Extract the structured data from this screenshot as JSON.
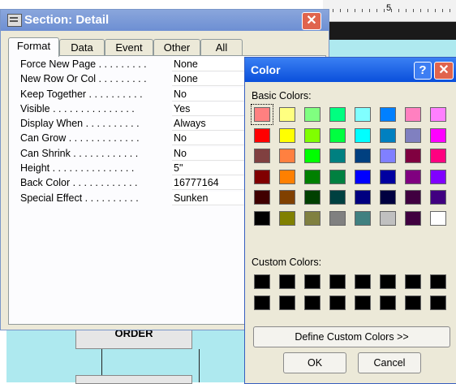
{
  "properties_window": {
    "title": "Section: Detail",
    "close_glyph": "✕",
    "tabs": [
      {
        "label": "Format",
        "active": true
      },
      {
        "label": "Data",
        "active": false
      },
      {
        "label": "Event",
        "active": false
      },
      {
        "label": "Other",
        "active": false
      },
      {
        "label": "All",
        "active": false
      }
    ],
    "properties": [
      {
        "name": "Force New Page . . . . . . . . .",
        "value": "None"
      },
      {
        "name": "New Row Or Col . . . . . . . . .",
        "value": "None"
      },
      {
        "name": "Keep Together . . . . . . . . . .",
        "value": "No"
      },
      {
        "name": "Visible . . . . . . . . . . . . . . .",
        "value": "Yes"
      },
      {
        "name": "Display When . . . . . . . . . .",
        "value": "Always"
      },
      {
        "name": "Can Grow . . . . . . . . . . . . .",
        "value": "No"
      },
      {
        "name": "Can Shrink . . . . . . . . . . . .",
        "value": "No"
      },
      {
        "name": "Height . . . . . . . . . . . . . . .",
        "value": "5\""
      },
      {
        "name": "Back Color . . . . . . . . . . . .",
        "value": "16777164"
      },
      {
        "name": "Special Effect . . . . . . . . . .",
        "value": "Sunken"
      }
    ]
  },
  "background": {
    "ruler_number": "5",
    "order_label": "ORDER"
  },
  "color_dialog": {
    "title": "Color",
    "help_glyph": "?",
    "close_glyph": "✕",
    "basic_colors_label": "Basic Colors:",
    "basic_colors": [
      [
        "#ff8080",
        "#ffff80",
        "#80ff80",
        "#00ff80",
        "#80ffff",
        "#0080ff",
        "#ff80c0",
        "#ff80ff"
      ],
      [
        "#ff0000",
        "#ffff00",
        "#80ff00",
        "#00ff40",
        "#00ffff",
        "#0080c0",
        "#8080c0",
        "#ff00ff"
      ],
      [
        "#804040",
        "#ff8040",
        "#00ff00",
        "#008080",
        "#004080",
        "#8080ff",
        "#800040",
        "#ff0080"
      ],
      [
        "#800000",
        "#ff8000",
        "#008000",
        "#008040",
        "#0000ff",
        "#0000a0",
        "#800080",
        "#8000ff"
      ],
      [
        "#400000",
        "#804000",
        "#004000",
        "#004040",
        "#000080",
        "#000040",
        "#400040",
        "#400080"
      ],
      [
        "#000000",
        "#808000",
        "#808040",
        "#808080",
        "#408080",
        "#c0c0c0",
        "#400040",
        "#ffffff"
      ]
    ],
    "selected_swatch": "#ff8080",
    "custom_colors_label": "Custom Colors:",
    "custom_colors": [
      [
        "#000000",
        "#000000",
        "#000000",
        "#000000",
        "#000000",
        "#000000",
        "#000000",
        "#000000"
      ],
      [
        "#000000",
        "#000000",
        "#000000",
        "#000000",
        "#000000",
        "#000000",
        "#000000",
        "#000000"
      ]
    ],
    "define_custom_label": "Define Custom Colors >>",
    "ok_label": "OK",
    "cancel_label": "Cancel"
  }
}
